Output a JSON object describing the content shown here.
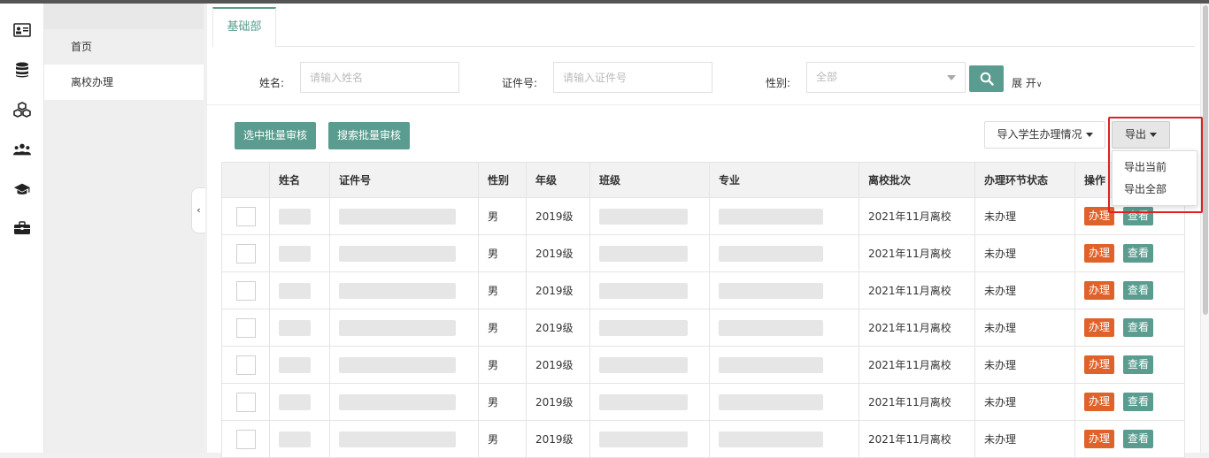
{
  "menu": {
    "items": [
      {
        "label": "首页",
        "active": false
      },
      {
        "label": "离校办理",
        "active": true
      }
    ]
  },
  "iconbar": [
    "id-card-icon",
    "database-icon",
    "cubes-icon",
    "users-icon",
    "graduation-cap-icon",
    "briefcase-icon"
  ],
  "tabs": [
    {
      "label": "基础部"
    }
  ],
  "filters": {
    "name_label": "姓名:",
    "name_placeholder": "请输入姓名",
    "id_label": "证件号:",
    "id_placeholder": "请输入证件号",
    "gender_label": "性别:",
    "gender_value": "全部",
    "expand_label": "展 开"
  },
  "actions": {
    "batch_selected": "选中批量审核",
    "batch_search": "搜索批量审核",
    "import_status": "导入学生办理情况",
    "export": "导出",
    "export_options": [
      "导出当前",
      "导出全部"
    ]
  },
  "table": {
    "headers": [
      "姓名",
      "证件号",
      "性别",
      "年级",
      "班级",
      "专业",
      "离校批次",
      "办理环节状态",
      "操作"
    ],
    "rows": [
      {
        "gender": "男",
        "grade": "2019级",
        "batch": "2021年11月离校",
        "status": "未办理"
      },
      {
        "gender": "男",
        "grade": "2019级",
        "batch": "2021年11月离校",
        "status": "未办理"
      },
      {
        "gender": "男",
        "grade": "2019级",
        "batch": "2021年11月离校",
        "status": "未办理"
      },
      {
        "gender": "男",
        "grade": "2019级",
        "batch": "2021年11月离校",
        "status": "未办理"
      },
      {
        "gender": "男",
        "grade": "2019级",
        "batch": "2021年11月离校",
        "status": "未办理"
      },
      {
        "gender": "男",
        "grade": "2019级",
        "batch": "2021年11月离校",
        "status": "未办理"
      },
      {
        "gender": "男",
        "grade": "2019级",
        "batch": "2021年11月离校",
        "status": "未办理"
      }
    ],
    "action_handle": "办理",
    "action_view": "查看"
  },
  "colors": {
    "accent": "#5a9c8f",
    "handle": "#e0622b",
    "highlight": "#e02020"
  }
}
